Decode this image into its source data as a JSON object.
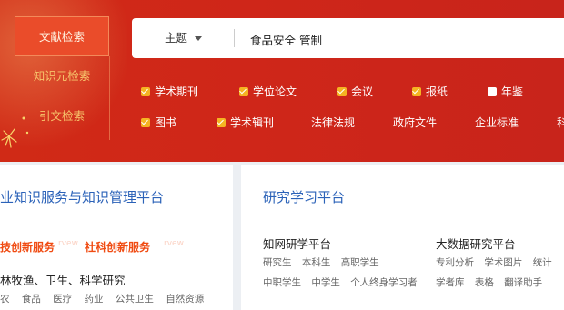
{
  "side_tabs": [
    "文献检索",
    "知识元检索",
    "引文检索"
  ],
  "search": {
    "scope_label": "主题",
    "query": "食品安全 管制"
  },
  "filters": [
    {
      "label": "学术期刊",
      "checked": true
    },
    {
      "label": "学位论文",
      "checked": true
    },
    {
      "label": "会议",
      "checked": true
    },
    {
      "label": "报纸",
      "checked": true
    },
    {
      "label": "年鉴",
      "checked": false
    },
    {
      "label": "图书",
      "checked": true
    },
    {
      "label": "学术辑刊",
      "checked": true
    },
    {
      "label": "法律法规",
      "checked": null
    },
    {
      "label": "政府文件",
      "checked": null
    },
    {
      "label": "企业标准",
      "checked": null
    },
    {
      "label": "科",
      "checked": null
    }
  ],
  "left_panel": {
    "title": "业知识服务与知识管理平台",
    "links_orange": [
      "技创新服务",
      "社科创新服务"
    ],
    "ghost_text": [
      "rvew",
      "rvew"
    ],
    "subtitle": "林牧渔、卫生、科学研究",
    "tags": [
      "农",
      "食品",
      "医疗",
      "药业",
      "公共卫生",
      "自然资源"
    ]
  },
  "right_panel": {
    "title": "研究学习平台",
    "col1_title": "知网研学平台",
    "col1_row1": [
      "研究生",
      "本科生",
      "高职学生"
    ],
    "col1_row2": [
      "中职学生",
      "中学生",
      "个人终身学习者"
    ],
    "col2_title": "大数据研究平台",
    "col2_row1": [
      "专利分析",
      "学术图片",
      "统计"
    ],
    "col2_row2": [
      "学者库",
      "表格",
      "翻译助手"
    ]
  }
}
